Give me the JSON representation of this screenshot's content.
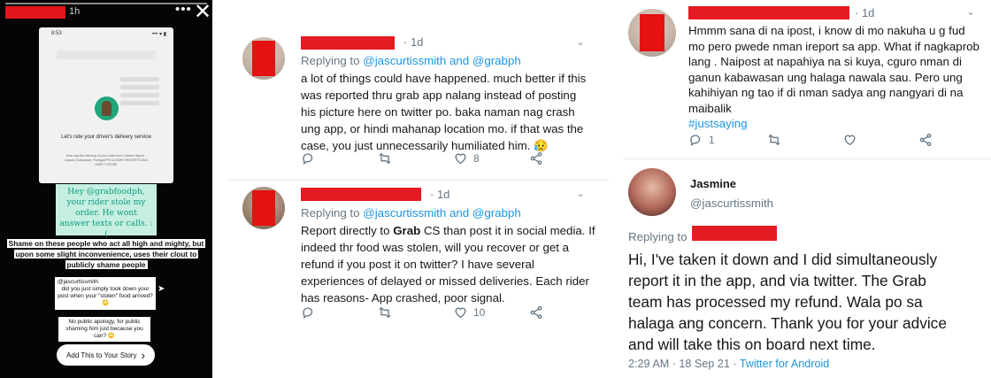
{
  "story": {
    "time": "1h",
    "phone_time": "8:53",
    "phone_status": "••• ▾ ▮",
    "rate_prompt": "Let's rate your driver's delivery service",
    "rate_fine": "How was the delivery of your order from Cheeze Sauce - Lacson (Caloocan), Puregold Ph LUXURY RESORTS AND PARTY STORE",
    "note": "Hey @grabfoodph, your rider stole my order. He wont answer texts or calls. :(",
    "caption": "Shame on these people who act all high and mighty, but upon some slight inconvenience, uses their clout to publicly shame people",
    "reply1_handle": "@jascurtissmith",
    "reply1_text": "did you just simply took down your post when your \"stolen\" food arrived? 🙄",
    "reply2_text": "No public apology, for public shaming him just because you can? 🙄",
    "add_story": "Add This to Your Story",
    "add_story_arrow": "›",
    "more_icon": "•••",
    "close_icon": "✕",
    "share_icon": "➤"
  },
  "tweets": [
    {
      "time": "· 1d",
      "replying_prefix": "Replying to",
      "replying_to": "@jascurtissmith and @grabph",
      "lines": [
        "a lot of things could have happened. much better if this",
        "was reported thru grab app nalang instead of posting",
        "his picture here on twitter po. baka naman nag crash",
        "ung app, or hindi mahanap location mo. if that was the",
        "case, you just unnecessarily humiliated him. 😥"
      ],
      "likes": "8"
    },
    {
      "time": "· 1d",
      "replying_prefix": "Replying to",
      "replying_to": "@jascurtissmith and @grabph",
      "lines_pre": "Report directly to ",
      "lines_bold": "Grab",
      "lines_post": " CS than post it in social media. If",
      "lines": [
        "indeed thr food was stolen, will you recover or get a",
        "refund if you post it on twitter? I have several",
        "experiences of delayed or missed deliveries. Each rider",
        "has reasons- App crashed, poor signal."
      ],
      "likes": "10"
    }
  ],
  "right_tweet": {
    "time": "· 1d",
    "lines": [
      "Hmmm sana di na ipost,  i know di mo nakuha u g fud",
      "mo pero pwede nman ireport sa app. What if nagkaprob",
      "lang . Naipost at napahiya na si kuya, cguro nman di",
      "ganun kabawasan ung halaga nawala sau. Pero ung",
      "kahihiyan ng tao if di nman sadya ang nangyari di na",
      "maibalik"
    ],
    "hashtag": "#justsaying",
    "replies": "1"
  },
  "jasmine": {
    "name": "Jasmine",
    "handle": "@jascurtissmith",
    "replying_prefix": "Replying to",
    "lines": [
      "Hi, I've taken it down and I did simultaneously",
      "report it in the app, and via twitter. The Grab",
      "team has processed my refund. Wala po sa",
      "halaga ang concern. Thank you for your advice",
      "and will take this on board next time."
    ],
    "timestamp": "2:29 AM · 18 Sep 21 · ",
    "source": "Twitter for Android"
  },
  "colors": {
    "redact": "#e41b23",
    "link": "#1b95e0",
    "muted": "#657786",
    "note_bg": "#c6efe2",
    "note_text": "#0f9c7d"
  }
}
